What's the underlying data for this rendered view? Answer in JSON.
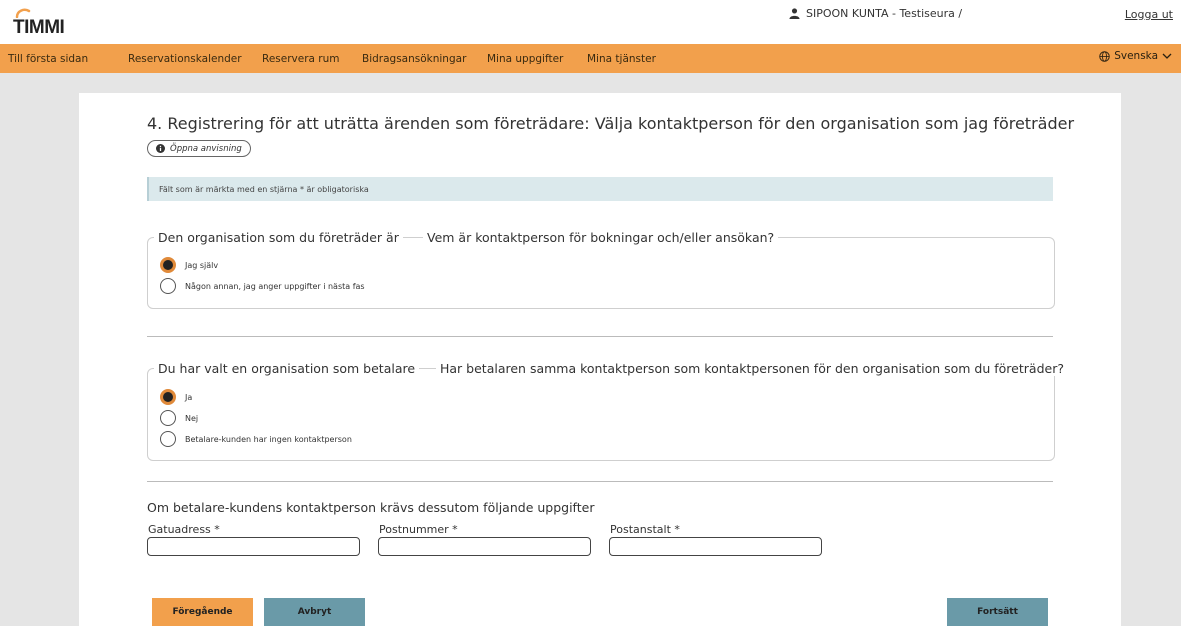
{
  "header": {
    "logo": "TIMMI",
    "user": "SIPOON KUNTA - Testiseura /",
    "logout": "Logga ut"
  },
  "nav": {
    "items": [
      "Till första sidan",
      "Reservationskalender",
      "Reservera rum",
      "Bidragsansökningar",
      "Mina uppgifter",
      "Mina tjänster"
    ],
    "language": "Svenska"
  },
  "page": {
    "title": "4. Registrering för att uträtta ärenden som företrädare: Välja kontaktperson för den organisation som jag företräder",
    "help_button": "Öppna anvisning",
    "required_note": "Fält som är märkta med en stjärna * är obligatoriska"
  },
  "section1": {
    "legend_a": "Den organisation som du företräder är",
    "legend_b": "Vem är kontaktperson för bokningar och/eller ansökan?",
    "options": [
      "Jag själv",
      "Någon annan, jag anger uppgifter i nästa fas"
    ],
    "selected": 0
  },
  "section2": {
    "legend_a": "Du har valt en organisation som betalare",
    "legend_b": "Har betalaren samma kontaktperson som kontaktpersonen för den organisation som du företräder?",
    "options": [
      "Ja",
      "Nej",
      "Betalare-kunden har ingen kontaktperson"
    ],
    "selected": 0
  },
  "section3": {
    "title": "Om betalare-kundens kontaktperson krävs dessutom följande uppgifter",
    "fields": [
      {
        "label": "Gatuadress *",
        "value": ""
      },
      {
        "label": "Postnummer *",
        "value": ""
      },
      {
        "label": "Postanstalt *",
        "value": ""
      }
    ]
  },
  "buttons": {
    "previous": "Föregående",
    "cancel": "Avbryt",
    "continue": "Fortsätt"
  },
  "colors": {
    "nav_bg": "#f2a04c",
    "btn_previous": "#f2a04c",
    "btn_secondary": "#6a9aa8",
    "info_bg": "#dbe9ec"
  }
}
